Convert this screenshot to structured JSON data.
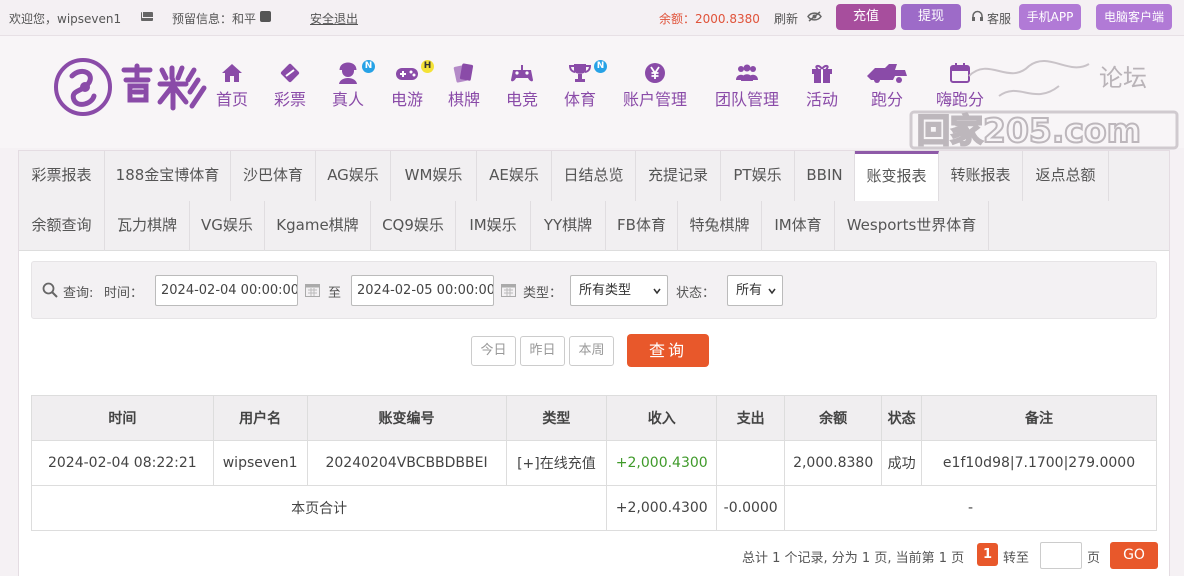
{
  "topbar": {
    "welcome": "欢迎您，wipseven1",
    "reserved_info": "预留信息：和平",
    "logout": "安全退出",
    "balance": "余额：2000.8380",
    "refresh": "刷新",
    "recharge": "充值",
    "withdraw": "提现",
    "customer_service": "客服",
    "mobile_app": "手机APP",
    "pc_client": "电脑客户端"
  },
  "nav": {
    "items": [
      {
        "label": "首页",
        "icon": "home-icon"
      },
      {
        "label": "彩票",
        "icon": "lottery-icon"
      },
      {
        "label": "真人",
        "icon": "live-dealer-icon",
        "badge": "N"
      },
      {
        "label": "电游",
        "icon": "gamepad-icon",
        "badge": "H"
      },
      {
        "label": "棋牌",
        "icon": "cards-icon"
      },
      {
        "label": "电竞",
        "icon": "esports-controller-icon"
      },
      {
        "label": "体育",
        "icon": "trophy-icon",
        "badge": "N"
      },
      {
        "label": "账户管理",
        "icon": "yen-coin-icon"
      },
      {
        "label": "团队管理",
        "icon": "team-icon"
      },
      {
        "label": "活动",
        "icon": "gift-icon"
      },
      {
        "label": "跑分",
        "icon": "running-icon"
      },
      {
        "label": "嗨跑分",
        "icon": "calendar-icon"
      }
    ],
    "watermark_site": "回家205.com",
    "watermark_forum": "论坛"
  },
  "tabs": {
    "row1": [
      "彩票报表",
      "188金宝博体育",
      "沙巴体育",
      "AG娱乐",
      "WM娱乐",
      "AE娱乐",
      "日结总览",
      "充提记录",
      "PT娱乐",
      "BBIN",
      "账变报表",
      "转账报表",
      "返点总额"
    ],
    "row2": [
      "余额查询",
      "瓦力棋牌",
      "VG娱乐",
      "Kgame棋牌",
      "CQ9娱乐",
      "IM娱乐",
      "YY棋牌",
      "FB体育",
      "特兔棋牌",
      "IM体育",
      "Wesports世界体育"
    ],
    "active": "账变报表"
  },
  "filter": {
    "query_label": "查询:",
    "time_label": "时间：",
    "start_time": "2024-02-04 00:00:00",
    "to_label": "至",
    "end_time": "2024-02-05 00:00:00",
    "type_label": "类型：",
    "type_value": "所有类型",
    "status_label": "状态：",
    "status_value": "所有",
    "today": "今日",
    "yesterday": "昨日",
    "this_week": "本周",
    "search": "查询"
  },
  "table": {
    "headers": [
      "时间",
      "用户名",
      "账变编号",
      "类型",
      "收入",
      "支出",
      "余额",
      "状态",
      "备注"
    ],
    "rows": [
      [
        "2024-02-04 08:22:21",
        "wipseven1",
        "20240204VBCBBDBBEI",
        "[+]在线充值",
        "+2,000.4300",
        "",
        "2,000.8380",
        "成功",
        "e1f10d98|7.1700|279.0000"
      ]
    ],
    "summary": {
      "label": "本页合计",
      "income": "+2,000.4300",
      "expense": "-0.0000",
      "note": "-"
    }
  },
  "pager": {
    "summary": "总计 1 个记录, 分为 1 页, 当前第 1 页",
    "current": "1",
    "goto_label": "转至",
    "page_unit": "页",
    "go": "GO"
  },
  "colors": {
    "brand_purple": "#8a4ba8",
    "recharge": "#a74e9d",
    "withdraw": "#9d6bc8",
    "accent_orange": "#e8582b",
    "balance_red": "#e0533a",
    "income_green": "#3f9a2a"
  }
}
